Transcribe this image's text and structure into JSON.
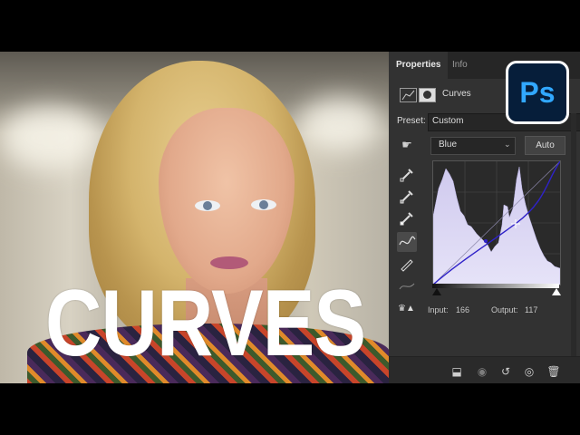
{
  "thumbnail": {
    "title": "CURVES",
    "logo_text": "Ps"
  },
  "panel": {
    "tabs": [
      "Properties",
      "Info"
    ],
    "adjustment_label": "Curves",
    "preset_label": "Preset:",
    "preset_value": "Custom",
    "channel_value": "Blue",
    "auto_label": "Auto",
    "input_label": "Input:",
    "input_value": "166",
    "output_label": "Output:",
    "output_value": "117"
  },
  "colors": {
    "panel_bg": "#323232",
    "histogram_fill": "#d7d2f0",
    "curve_line": "#2f22c8",
    "ps_blue": "#31a8ff",
    "ps_bg": "#061e3a"
  },
  "icons": {
    "adjustment": "curves-adjustment-icon",
    "mask": "mask-icon",
    "target_tool": "on-image-target-icon",
    "black_eyedropper": "eyedropper-black-icon",
    "gray_eyedropper": "eyedropper-gray-icon",
    "white_eyedropper": "eyedropper-white-icon",
    "curve_tool": "curve-tool-icon",
    "pencil_tool": "pencil-icon",
    "smooth_tool": "smooth-icon",
    "clipping_warning": "clipping-warning-icon"
  }
}
